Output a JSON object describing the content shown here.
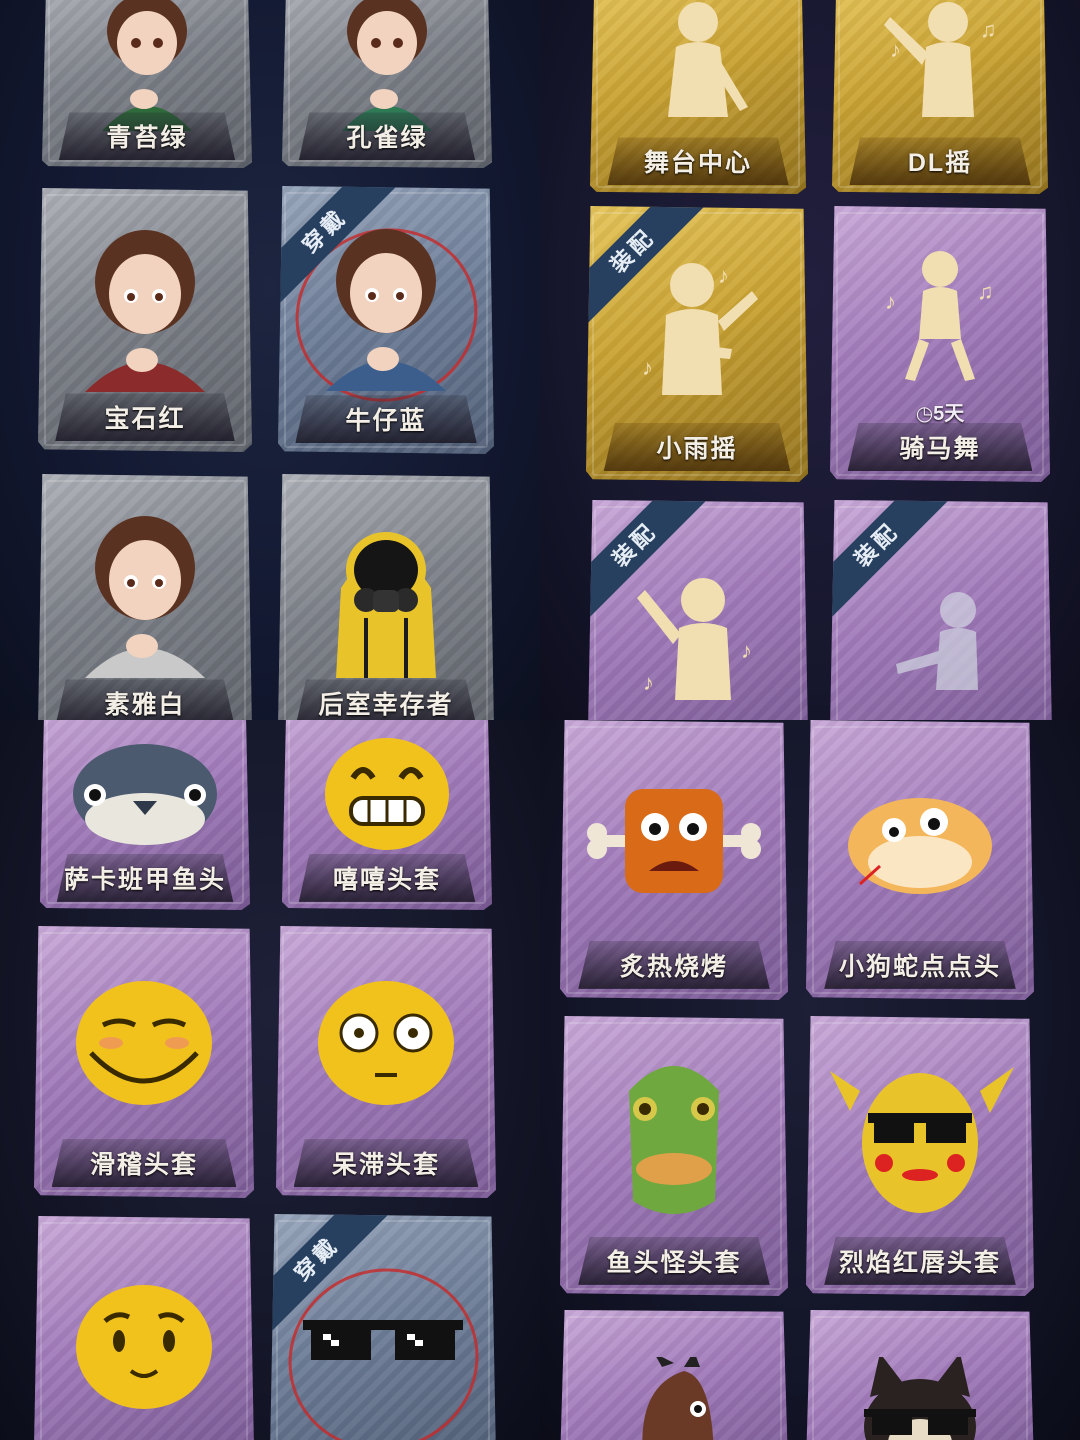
{
  "panels": {
    "outfits": {
      "cards": [
        {
          "label": "青苔绿",
          "color": "#2f6a3a"
        },
        {
          "label": "孔雀绿",
          "color": "#2e7a55"
        },
        {
          "label": "宝石红",
          "color": "#8c2b2b"
        },
        {
          "label": "牛仔蓝",
          "color": "#3b5e8c",
          "badge": "穿戴"
        },
        {
          "label": "素雅白",
          "color": "#c9c9c9"
        },
        {
          "label": "后室幸存者",
          "color": "#e8c42a"
        }
      ]
    },
    "emotes": {
      "cards": [
        {
          "label": "舞台中心",
          "rarity": "gold"
        },
        {
          "label": "DL摇",
          "rarity": "gold"
        },
        {
          "label": "小雨摇",
          "rarity": "gold",
          "badge": "装配"
        },
        {
          "label": "骑马舞",
          "rarity": "purple",
          "duration": "5天"
        },
        {
          "label": "",
          "rarity": "purple",
          "badge": "装配"
        },
        {
          "label": "",
          "rarity": "purple",
          "badge": "装配"
        }
      ]
    },
    "headgear_left": {
      "cards": [
        {
          "label": "萨卡班甲鱼头"
        },
        {
          "label": "嘻嘻头套"
        },
        {
          "label": "滑稽头套"
        },
        {
          "label": "呆滞头套"
        },
        {
          "label": ""
        },
        {
          "label": "",
          "badge": "穿戴"
        }
      ]
    },
    "headgear_right": {
      "cards": [
        {
          "label": "炙热烧烤"
        },
        {
          "label": "小狗蛇点点头"
        },
        {
          "label": "鱼头怪头套"
        },
        {
          "label": "烈焰红唇头套"
        },
        {
          "label": ""
        },
        {
          "label": ""
        }
      ]
    }
  },
  "icons": {
    "clock": "clock-icon"
  }
}
